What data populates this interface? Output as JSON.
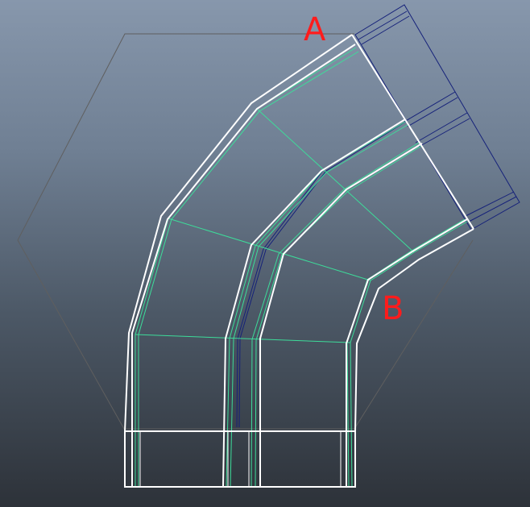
{
  "viewport": {
    "background_top": "#8797ac",
    "background_bottom": "#2d3239"
  },
  "colors": {
    "outline": "#ffffff",
    "inner_edges": "#3ddc9a",
    "selection": "#16227a",
    "reference": "#5f5f5f",
    "annotation": "#ff1c1c"
  },
  "labels": {
    "a": "A",
    "b": "B"
  }
}
